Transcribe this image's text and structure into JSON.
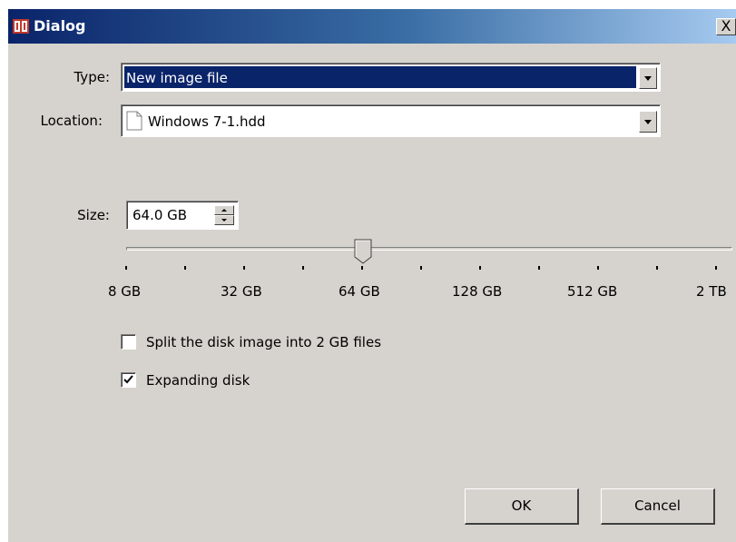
{
  "window": {
    "title": "Dialog",
    "close_label": "X"
  },
  "form": {
    "type_label": "Type:",
    "type_value": "New image file",
    "location_label": "Location:",
    "location_value": "Windows 7-1.hdd",
    "size_label": "Size:",
    "size_value": "64.0 GB"
  },
  "slider": {
    "tick_labels": [
      "8 GB",
      "32 GB",
      "64 GB",
      "128 GB",
      "512 GB",
      "2 TB"
    ],
    "selected_value": "64 GB"
  },
  "options": {
    "split_label": "Split the disk image into 2 GB files",
    "split_checked": false,
    "expanding_label": "Expanding disk",
    "expanding_checked": true
  },
  "buttons": {
    "ok_label": "OK",
    "cancel_label": "Cancel"
  },
  "colors": {
    "selection": "#0a246a",
    "dialog_bg": "#d6d3ce"
  }
}
